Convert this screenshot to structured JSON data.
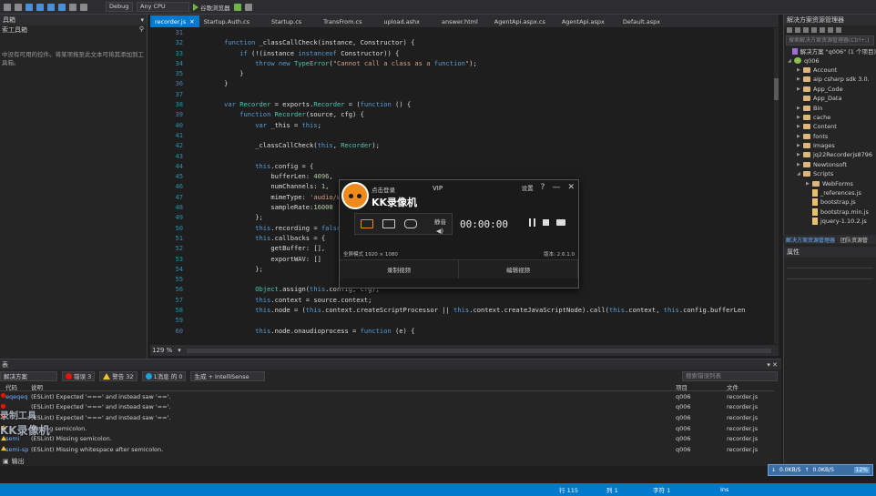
{
  "toolbar": {
    "config": "Debug",
    "platform": "Any CPU",
    "run_label": "谷歌浏览器"
  },
  "left_panel": {
    "title": "具箱",
    "search_label": "索工具箱",
    "empty_message": "中没有可用的控件。将某项拖至此文本可将其添加到工具箱。"
  },
  "tabs": [
    {
      "label": "recorder.js",
      "active": true
    },
    {
      "label": "Startup.Auth.cs"
    },
    {
      "label": "Startup.cs"
    },
    {
      "label": "TransFrom.cs"
    },
    {
      "label": "upload.ashx"
    },
    {
      "label": "answer.html"
    },
    {
      "label": "AgentApi.aspx.cs"
    },
    {
      "label": "AgentApi.aspx"
    },
    {
      "label": "Default.aspx"
    }
  ],
  "editor": {
    "lines": [
      {
        "n": "31",
        "indent": "",
        "code": ""
      },
      {
        "n": "32",
        "indent": "    ",
        "code": "function _classCallCheck(instance, Constructor) {"
      },
      {
        "n": "33",
        "indent": "        ",
        "code": "if (!(instance instanceof Constructor)) {"
      },
      {
        "n": "34",
        "indent": "            ",
        "code": "throw new TypeError(\"Cannot call a class as a function\");"
      },
      {
        "n": "35",
        "indent": "        ",
        "code": "}"
      },
      {
        "n": "36",
        "indent": "    ",
        "code": "}"
      },
      {
        "n": "37",
        "indent": "",
        "code": ""
      },
      {
        "n": "38",
        "indent": "    ",
        "code": "var Recorder = exports.Recorder = (function () {"
      },
      {
        "n": "39",
        "indent": "        ",
        "code": "function Recorder(source, cfg) {"
      },
      {
        "n": "40",
        "indent": "            ",
        "code": "var _this = this;"
      },
      {
        "n": "41",
        "indent": "",
        "code": ""
      },
      {
        "n": "42",
        "indent": "            ",
        "code": "_classCallCheck(this, Recorder);"
      },
      {
        "n": "43",
        "indent": "",
        "code": ""
      },
      {
        "n": "44",
        "indent": "            ",
        "code": "this.config = {"
      },
      {
        "n": "45",
        "indent": "                ",
        "code": "bufferLen: 4096,"
      },
      {
        "n": "46",
        "indent": "                ",
        "code": "numChannels: 1,"
      },
      {
        "n": "47",
        "indent": "                ",
        "code": "mimeType: 'audio/wa"
      },
      {
        "n": "48",
        "indent": "                ",
        "code": "sampleRate:16000"
      },
      {
        "n": "49",
        "indent": "            ",
        "code": "};"
      },
      {
        "n": "50",
        "indent": "            ",
        "code": "this.recording = false;"
      },
      {
        "n": "51",
        "indent": "            ",
        "code": "this.callbacks = {"
      },
      {
        "n": "52",
        "indent": "                ",
        "code": "getBuffer: [],"
      },
      {
        "n": "53",
        "indent": "                ",
        "code": "exportWAV: []"
      },
      {
        "n": "54",
        "indent": "            ",
        "code": "};"
      },
      {
        "n": "55",
        "indent": "",
        "code": ""
      },
      {
        "n": "56",
        "indent": "            ",
        "code": "Object.assign(this.config, cfg);"
      },
      {
        "n": "57",
        "indent": "            ",
        "code": "this.context = source.context;"
      },
      {
        "n": "58",
        "indent": "            ",
        "code": "this.node = (this.context.createScriptProcessor || this.context.createJavaScriptNode).call(this.context, this.config.bufferLen"
      },
      {
        "n": "59",
        "indent": "",
        "code": ""
      },
      {
        "n": "60",
        "indent": "            ",
        "code": "this.node.onaudioprocess = function (e) {"
      }
    ],
    "zoom": "129 %"
  },
  "solution_explorer": {
    "title": "解决方案资源管理器",
    "search_placeholder": "搜索解决方案资源管理器(Ctrl+;)",
    "items": [
      {
        "label": "解决方案 \"q006\" (1 个项目)",
        "type": "sol",
        "depth": 0,
        "exp": ""
      },
      {
        "label": "q006",
        "type": "proj",
        "depth": 0,
        "exp": "◢"
      },
      {
        "label": "Account",
        "type": "folder",
        "depth": 1,
        "exp": "▶"
      },
      {
        "label": "aip csharp sdk 3.0.",
        "type": "folder",
        "depth": 1,
        "exp": "▶"
      },
      {
        "label": "App_Code",
        "type": "folder",
        "depth": 1,
        "exp": "▶"
      },
      {
        "label": "App_Data",
        "type": "folder",
        "depth": 1,
        "exp": ""
      },
      {
        "label": "Bin",
        "type": "folder",
        "depth": 1,
        "exp": "▶"
      },
      {
        "label": "cache",
        "type": "folder",
        "depth": 1,
        "exp": "▶"
      },
      {
        "label": "Content",
        "type": "folder",
        "depth": 1,
        "exp": "▶"
      },
      {
        "label": "fonts",
        "type": "folder",
        "depth": 1,
        "exp": "▶"
      },
      {
        "label": "Images",
        "type": "folder",
        "depth": 1,
        "exp": "▶"
      },
      {
        "label": "jq22Recorderjs8796",
        "type": "folder",
        "depth": 1,
        "exp": "▶"
      },
      {
        "label": "Newtonsoft",
        "type": "folder",
        "depth": 1,
        "exp": "▶"
      },
      {
        "label": "Scripts",
        "type": "folder",
        "depth": 1,
        "exp": "◢"
      },
      {
        "label": "WebForms",
        "type": "folder",
        "depth": 2,
        "exp": "▶"
      },
      {
        "label": "_references.js",
        "type": "file",
        "depth": 2,
        "exp": ""
      },
      {
        "label": "bootstrap.js",
        "type": "file",
        "depth": 2,
        "exp": ""
      },
      {
        "label": "bootstrap.min.js",
        "type": "file",
        "depth": 2,
        "exp": ""
      },
      {
        "label": "jquery-1.10.2.js",
        "type": "file",
        "depth": 2,
        "exp": ""
      }
    ],
    "bottom_tabs": [
      "解决方案资源管理器",
      "团队资源管"
    ]
  },
  "properties": {
    "title": "属性"
  },
  "error_list": {
    "title": "表",
    "scope": "解决方案",
    "errors": "错误 3",
    "warnings": "警告 32",
    "messages": "1消息 的 0",
    "build_mode": "生成 + IntelliSense",
    "search_placeholder": "搜索错误列表",
    "columns": {
      "code": "代码",
      "desc": "说明",
      "project": "项目",
      "file": "文件"
    },
    "rows": [
      {
        "icon": "err",
        "code": "eqeqeq",
        "desc": "(ESLint) Expected '===' and instead saw '=='.",
        "project": "q006",
        "file": "recorder.js"
      },
      {
        "icon": "err",
        "code": "",
        "desc": "(ESLint) Expected '===' and instead saw '=='.",
        "project": "q006",
        "file": "recorder.js"
      },
      {
        "icon": "err",
        "code": "",
        "desc": "(ESLint) Expected '===' and instead saw '=='.",
        "project": "q006",
        "file": "recorder.js"
      },
      {
        "icon": "warn",
        "code": "",
        "desc": "Missing semicolon.",
        "project": "q006",
        "file": "recorder.js"
      },
      {
        "icon": "warn",
        "code": "semi",
        "desc": "(ESLint) Missing semicolon.",
        "project": "q006",
        "file": "recorder.js"
      },
      {
        "icon": "warn",
        "code": "semi-sp",
        "desc": "(ESLint) Missing whitespace after semicolon.",
        "project": "q006",
        "file": "recorder.js"
      }
    ],
    "footer": "输出"
  },
  "statusbar": {
    "row": "行 115",
    "col": "列 1",
    "char": "字符 1",
    "mode": "Ins"
  },
  "network": {
    "down": "0.0KB/S",
    "up": "0.0KB/S",
    "pct": "12%"
  },
  "watermark": {
    "line1": "录制工具",
    "line2": "KK录像机"
  },
  "kk_recorder": {
    "login": "点击登录",
    "title": "KK录像机",
    "vip": "VIP",
    "settings": "设置",
    "help": "?",
    "min": "—",
    "close": "✕",
    "sound": "静音",
    "volume": "◀)",
    "timer": "00:00:00",
    "res": "全屏模式 1920 × 1080",
    "version": "版本: 2.6.1.0",
    "btn_record": "录制视频",
    "btn_edit": "编辑视频"
  }
}
